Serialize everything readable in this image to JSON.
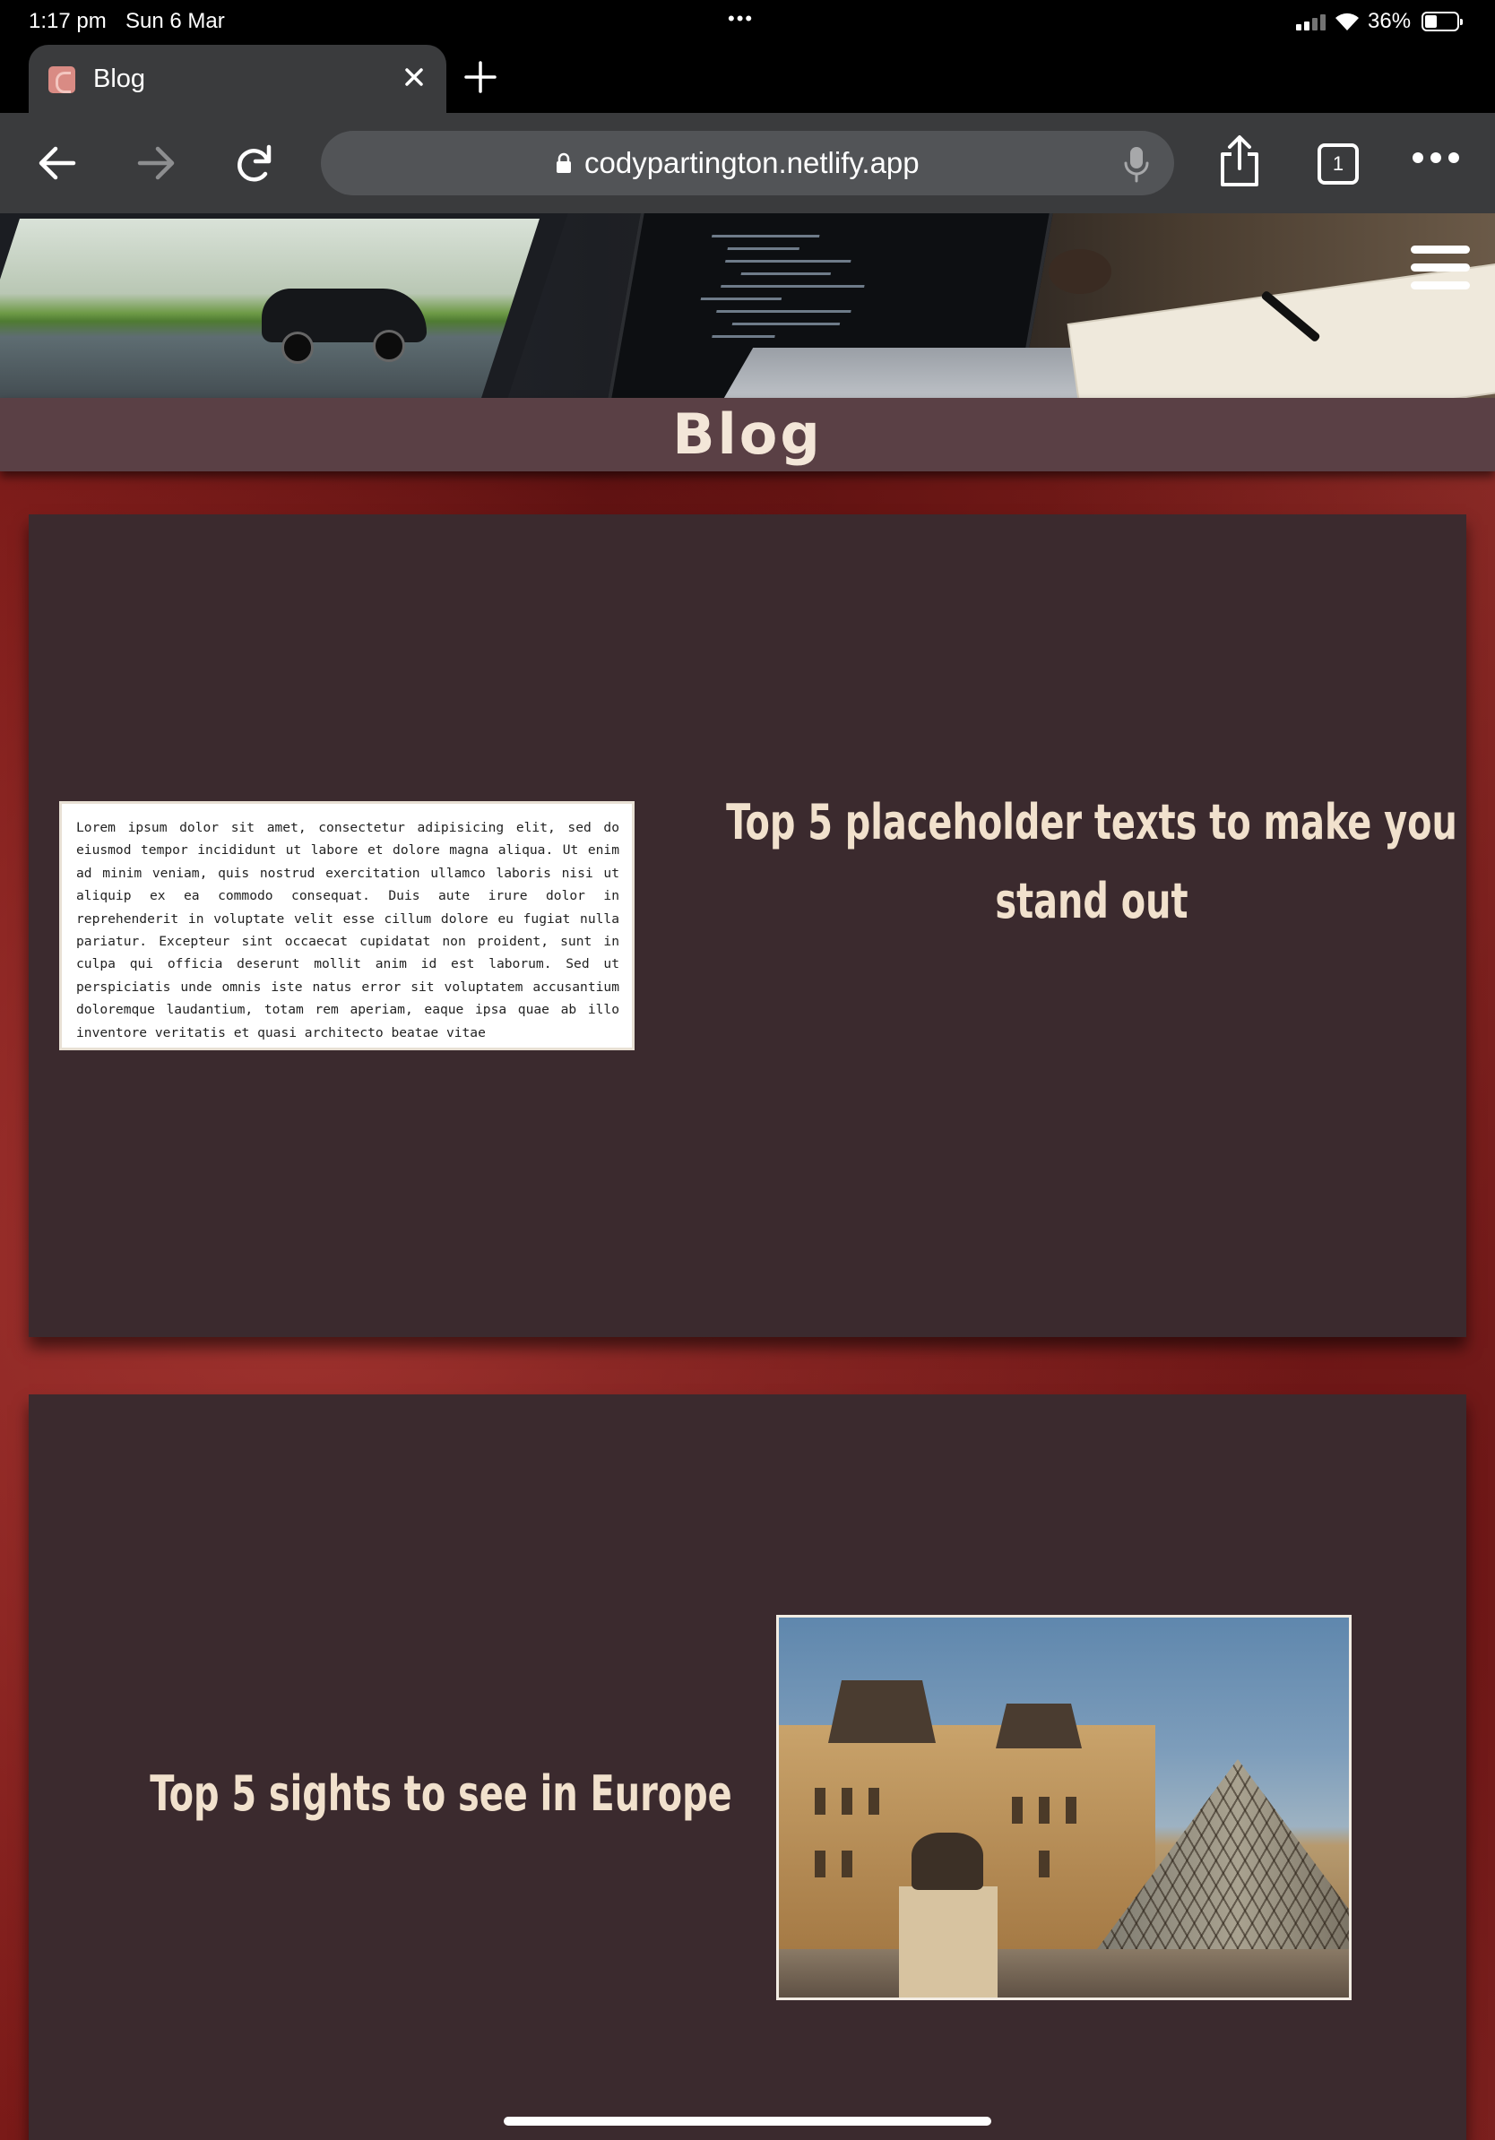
{
  "status_bar": {
    "time": "1:17 pm",
    "date": "Sun 6 Mar",
    "dots": "•••",
    "battery_percent": "36%",
    "battery_level": 0.36
  },
  "tab": {
    "title": "Blog",
    "close_icon": "close-icon",
    "new_tab_icon": "plus-icon"
  },
  "toolbar": {
    "url": "codypartington.netlify.app",
    "tabs_count": "1",
    "icons": [
      "back-arrow-icon",
      "forward-arrow-icon",
      "reload-icon",
      "lock-icon",
      "microphone-icon",
      "share-icon",
      "tabs-icon",
      "more-icon"
    ]
  },
  "page": {
    "title": "Blog",
    "menu_icon": "hamburger-menu-icon",
    "colors": {
      "title_bar": "#5a4045",
      "card": "#3b2a2e",
      "heading_text": "#f1e1cd"
    },
    "posts": [
      {
        "title": "Top 5 placeholder texts to make you stand out",
        "thumbnail_text": "Lorem ipsum dolor sit amet, consectetur adipisicing elit, sed do eiusmod tempor incididunt ut labore et dolore magna aliqua. Ut enim ad minim veniam, quis nostrud exercitation ullamco laboris nisi ut aliquip ex ea commodo consequat. Duis aute irure dolor in reprehenderit in voluptate velit esse cillum dolore eu fugiat nulla pariatur. Excepteur sint occaecat cupidatat non proident, sunt in culpa qui officia deserunt mollit anim id est laborum. Sed ut perspiciatis unde omnis iste natus error sit voluptatem accusantium doloremque laudantium, totam rem aperiam, eaque ipsa quae ab illo inventore veritatis et quasi architecto beatae vitae"
      },
      {
        "title": "Top 5 sights to see in Europe"
      }
    ]
  }
}
